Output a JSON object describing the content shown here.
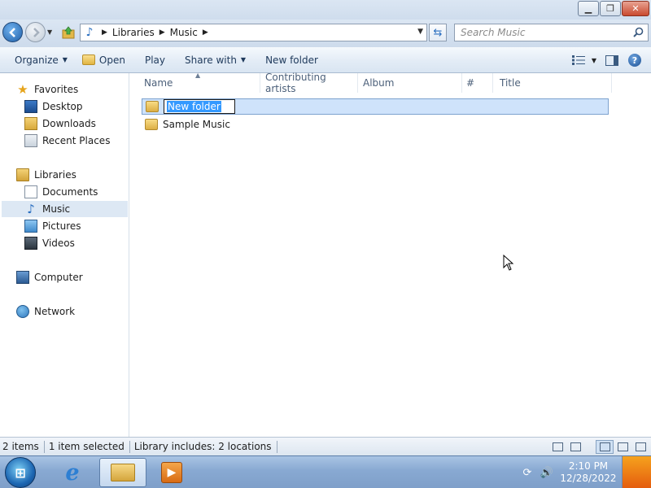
{
  "window": {
    "minimize_glyph": "▁",
    "restore_glyph": "❐",
    "close_glyph": "✕"
  },
  "address": {
    "breadcrumbs": [
      "Libraries",
      "Music"
    ]
  },
  "search": {
    "placeholder": "Search Music"
  },
  "toolbar": {
    "organize": "Organize",
    "open": "Open",
    "play": "Play",
    "share_with": "Share with",
    "new_folder": "New folder"
  },
  "nav": {
    "favorites": "Favorites",
    "desktop": "Desktop",
    "downloads": "Downloads",
    "recent_places": "Recent Places",
    "libraries": "Libraries",
    "documents": "Documents",
    "music": "Music",
    "pictures": "Pictures",
    "videos": "Videos",
    "computer": "Computer",
    "network": "Network"
  },
  "columns": {
    "name": "Name",
    "contributing_artists": "Contributing artists",
    "album": "Album",
    "number": "#",
    "title": "Title"
  },
  "files": [
    {
      "name": "New folder",
      "renaming": true
    },
    {
      "name": "Sample Music",
      "renaming": false
    }
  ],
  "status": {
    "items": "2 items",
    "selected": "1 item selected",
    "library_includes": "Library includes:  2 locations"
  },
  "clock": {
    "time": "2:10 PM",
    "date": "12/28/2022"
  },
  "icons": {
    "favorites": "star-icon",
    "music": "music-note-icon",
    "search": "magnifier-icon"
  }
}
